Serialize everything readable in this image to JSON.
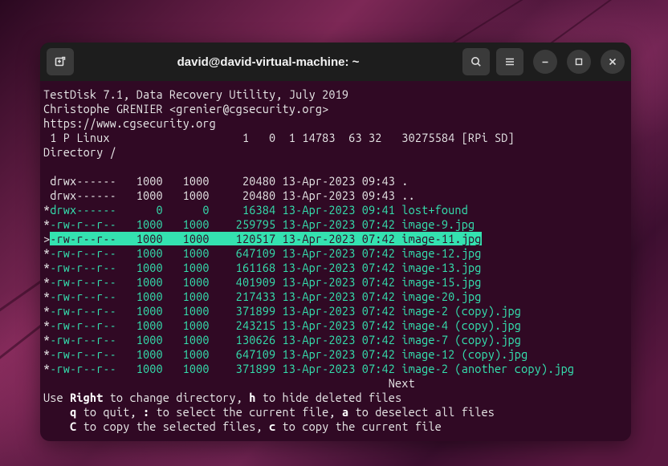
{
  "window": {
    "title": "david@david-virtual-machine: ~"
  },
  "app": {
    "header_lines": [
      "TestDisk 7.1, Data Recovery Utility, July 2019",
      "Christophe GRENIER <grenier@cgsecurity.org>",
      "https://www.cgsecurity.org"
    ],
    "partition_line": " 1 P Linux                    1   0  1 14783  63 32   30275584 [RPi SD]",
    "directory_line": "Directory /",
    "files": [
      {
        "mark": " ",
        "perm": "drwx------",
        "uid": " 1000",
        "gid": " 1000",
        "size": "    20480",
        "date": "13-Apr-2023 09:43",
        "name": ".",
        "deleted": false
      },
      {
        "mark": " ",
        "perm": "drwx------",
        "uid": " 1000",
        "gid": " 1000",
        "size": "    20480",
        "date": "13-Apr-2023 09:43",
        "name": "..",
        "deleted": false
      },
      {
        "mark": "*",
        "perm": "drwx------",
        "uid": "    0",
        "gid": "    0",
        "size": "    16384",
        "date": "13-Apr-2023 09:41",
        "name": "lost+found",
        "deleted": true
      },
      {
        "mark": "*",
        "perm": "-rw-r--r--",
        "uid": " 1000",
        "gid": " 1000",
        "size": "   259795",
        "date": "13-Apr-2023 07:42",
        "name": "image-9.jpg",
        "deleted": true
      },
      {
        "mark": ">",
        "perm": "-rw-r--r--",
        "uid": " 1000",
        "gid": " 1000",
        "size": "   120517",
        "date": "13-Apr-2023 07:42",
        "name": "image-11.jpg",
        "selected": true,
        "deleted": true
      },
      {
        "mark": "*",
        "perm": "-rw-r--r--",
        "uid": " 1000",
        "gid": " 1000",
        "size": "   647109",
        "date": "13-Apr-2023 07:42",
        "name": "image-12.jpg",
        "deleted": true
      },
      {
        "mark": "*",
        "perm": "-rw-r--r--",
        "uid": " 1000",
        "gid": " 1000",
        "size": "   161168",
        "date": "13-Apr-2023 07:42",
        "name": "image-13.jpg",
        "deleted": true
      },
      {
        "mark": "*",
        "perm": "-rw-r--r--",
        "uid": " 1000",
        "gid": " 1000",
        "size": "   401909",
        "date": "13-Apr-2023 07:42",
        "name": "image-15.jpg",
        "deleted": true
      },
      {
        "mark": "*",
        "perm": "-rw-r--r--",
        "uid": " 1000",
        "gid": " 1000",
        "size": "   217433",
        "date": "13-Apr-2023 07:42",
        "name": "image-20.jpg",
        "deleted": true
      },
      {
        "mark": "*",
        "perm": "-rw-r--r--",
        "uid": " 1000",
        "gid": " 1000",
        "size": "   371899",
        "date": "13-Apr-2023 07:42",
        "name": "image-2 (copy).jpg",
        "deleted": true
      },
      {
        "mark": "*",
        "perm": "-rw-r--r--",
        "uid": " 1000",
        "gid": " 1000",
        "size": "   243215",
        "date": "13-Apr-2023 07:42",
        "name": "image-4 (copy).jpg",
        "deleted": true
      },
      {
        "mark": "*",
        "perm": "-rw-r--r--",
        "uid": " 1000",
        "gid": " 1000",
        "size": "   130626",
        "date": "13-Apr-2023 07:42",
        "name": "image-7 (copy).jpg",
        "deleted": true
      },
      {
        "mark": "*",
        "perm": "-rw-r--r--",
        "uid": " 1000",
        "gid": " 1000",
        "size": "   647109",
        "date": "13-Apr-2023 07:42",
        "name": "image-12 (copy).jpg",
        "deleted": true
      },
      {
        "mark": "*",
        "perm": "-rw-r--r--",
        "uid": " 1000",
        "gid": " 1000",
        "size": "   371899",
        "date": "13-Apr-2023 07:42",
        "name": "image-2 (another copy).jpg",
        "deleted": true
      }
    ],
    "next_label": "Next",
    "help": {
      "l1_pre": "Use ",
      "l1_k1": "Right",
      "l1_mid": " to change directory, ",
      "l1_k2": "h",
      "l1_post": " to hide deleted files",
      "l2_k1": "q",
      "l2_t1": " to quit, ",
      "l2_k2": ":",
      "l2_t2": " to select the current file, ",
      "l2_k3": "a",
      "l2_t3": " to deselect all files",
      "l3_k1": "C",
      "l3_t1": " to copy the selected files, ",
      "l3_k2": "c",
      "l3_t2": " to copy the current file"
    }
  }
}
